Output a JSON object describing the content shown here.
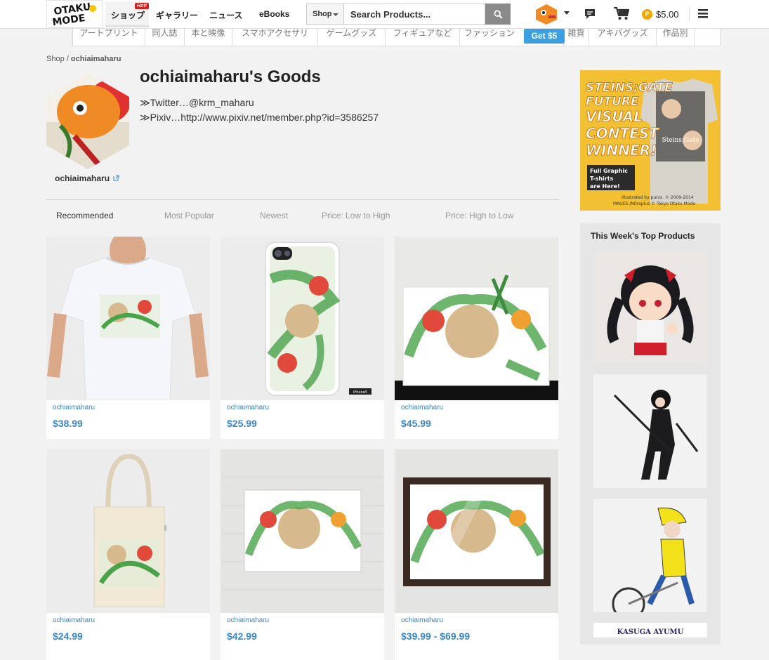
{
  "header": {
    "logo_text": "OTAKU MODE",
    "nav": [
      "ショップ",
      "ギャラリー",
      "ニュース",
      "eBooks"
    ],
    "hot_badge": "Hot!",
    "search_scope": "Shop",
    "search_placeholder": "Search Products...",
    "balance": "$5.00",
    "coin_label": "P"
  },
  "categories": [
    "アートプリント",
    "同人誌",
    "本と映像",
    "スマホアクセサリ",
    "ゲームグッズ",
    "フィギュアなど",
    "ファッション",
    "雑貨",
    "アキバグッズ",
    "作品別"
  ],
  "promo_badge": "Get $5",
  "breadcrumb": {
    "root": "Shop",
    "sep": "/",
    "current": "ochiaimaharu"
  },
  "profile": {
    "title": "ochiaimaharu's Goods",
    "bio_line1": "≫Twitter…@krm_maharu",
    "bio_line2": "≫Pixiv…http://www.pixiv.net/member.php?id=3586257",
    "name": "ochiaimaharu"
  },
  "sort_tabs": [
    "Recommended",
    "Most Popular",
    "Newest",
    "Price: Low to High",
    "Price: High to Low"
  ],
  "products": [
    {
      "seller": "ochiaimaharu",
      "price": "$38.99",
      "kind": "tshirt"
    },
    {
      "seller": "ochiaimaharu",
      "price": "$25.99",
      "kind": "phonecase"
    },
    {
      "seller": "ochiaimaharu",
      "price": "$45.99",
      "kind": "poster"
    },
    {
      "seller": "ochiaimaharu",
      "price": "$24.99",
      "kind": "tote"
    },
    {
      "seller": "ochiaimaharu",
      "price": "$42.99",
      "kind": "canvas"
    },
    {
      "seller": "ochiaimaharu",
      "price": "$39.99 - $69.99",
      "kind": "framed"
    }
  ],
  "phone_label": "iPhone5",
  "ad": {
    "headline": [
      "STEINS;GATE",
      "FUTURE",
      "VISUAL",
      "CONTEST",
      "WINNER!"
    ],
    "sub": [
      "Full Graphic",
      "T-shirts",
      "are Here!"
    ],
    "credit": [
      "Illustrated by punix. © 2009-2014",
      "MAGES./Nitroplus © Tokyo Otaku Mode"
    ],
    "shirt_text": "Steins;Gate"
  },
  "sidebar": {
    "title": "This Week's Top Products",
    "last_thumb_text": "KASUGA AYUMU"
  },
  "colors": {
    "link": "#3a86c8",
    "accent": "#3ca0e0",
    "ad_bg": "#f3c033"
  }
}
